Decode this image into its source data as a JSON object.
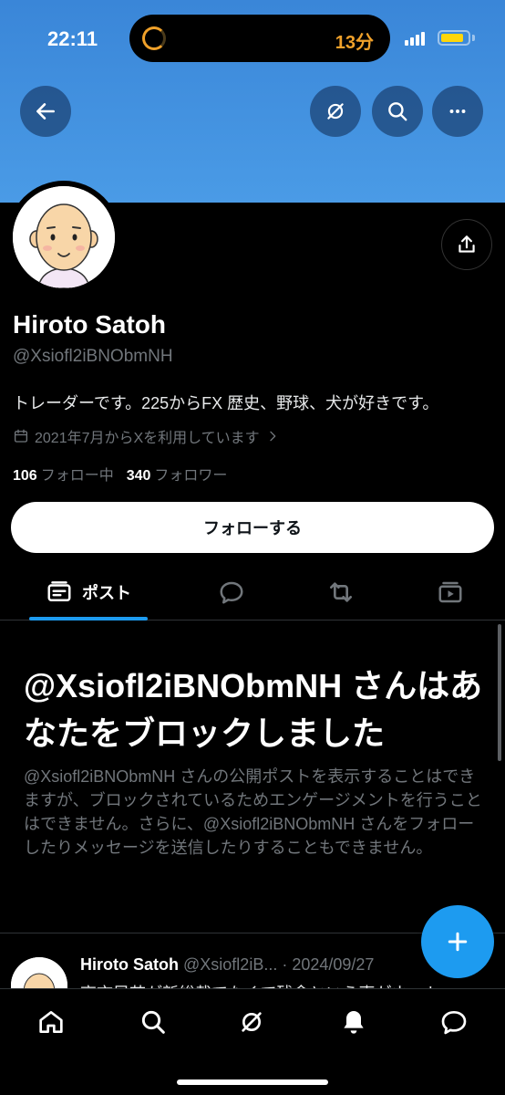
{
  "status_bar": {
    "time": "22:11",
    "activity": "13分"
  },
  "header": {
    "back": "back-arrow-icon",
    "actions": [
      "no-grok-icon",
      "search-icon",
      "more-icon"
    ]
  },
  "profile": {
    "name": "Hiroto Satoh",
    "handle": "@Xsiofl2iBNObmNH",
    "bio": "トレーダーです。225からFX 歴史、野球、犬が好きです。",
    "joined": "2021年7月からXを利用しています",
    "following_count": "106",
    "following_label": "フォロー中",
    "followers_count": "340",
    "followers_label": "フォロワー",
    "follow_button": "フォローする"
  },
  "tabs": [
    {
      "label": "ポスト",
      "icon": "posts-icon",
      "active": true
    },
    {
      "label": "",
      "icon": "reply-icon"
    },
    {
      "label": "",
      "icon": "retweet-icon"
    },
    {
      "label": "",
      "icon": "media-icon"
    }
  ],
  "blocked": {
    "title": "@Xsiofl2iBNObmNH さんはあなたをブロックしました",
    "description": "@Xsiofl2iBNObmNH さんの公開ポストを表示することはできますが、ブロックされているためエンゲージメントを行うことはできません。さらに、@Xsiofl2iBNObmNH さんをフォローしたりメッセージを送信したりすることもできません。"
  },
  "post": {
    "author": "Hiroto Satoh",
    "handle_date": "@Xsiofl2iB... · 2024/09/27",
    "text": "高市早苗が新総裁でなくて残念という声がネット"
  },
  "fab_label": "+",
  "bottom_nav": [
    "home-icon",
    "search-icon",
    "grok-icon",
    "notifications-icon",
    "messages-icon"
  ],
  "colors": {
    "accent": "#1d9bf0",
    "banner": "#4a9be6",
    "background": "#000000",
    "muted": "#71767b"
  }
}
